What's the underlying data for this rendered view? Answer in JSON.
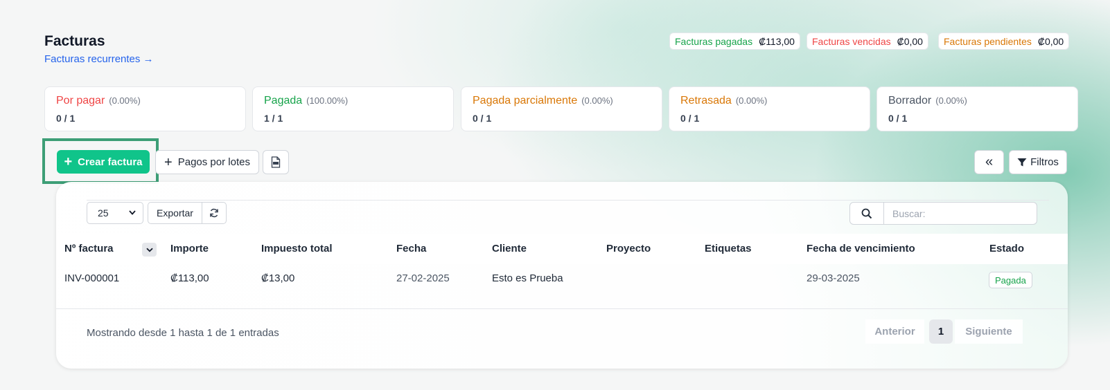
{
  "header": {
    "title": "Facturas",
    "recurring_link": "Facturas recurrentes →"
  },
  "summary": [
    {
      "label": "Facturas pagadas",
      "amount": "₡113,00",
      "color": "#16a34a"
    },
    {
      "label": "Facturas vencidas",
      "amount": "₡0,00",
      "color": "#ef4444"
    },
    {
      "label": "Facturas pendientes",
      "amount": "₡0,00",
      "color": "#d97706"
    }
  ],
  "status_cards": [
    {
      "label": "Por pagar",
      "percent": "(0.00%)",
      "count": "0 / 1",
      "color": "#ef4444"
    },
    {
      "label": "Pagada",
      "percent": "(100.00%)",
      "count": "1 / 1",
      "color": "#16a34a"
    },
    {
      "label": "Pagada parcialmente",
      "percent": "(0.00%)",
      "count": "0 / 1",
      "color": "#d97706"
    },
    {
      "label": "Retrasada",
      "percent": "(0.00%)",
      "count": "0 / 1",
      "color": "#d97706"
    },
    {
      "label": "Borrador",
      "percent": "(0.00%)",
      "count": "0 / 1",
      "color": "#4b5563"
    }
  ],
  "toolbar": {
    "create_label": "Crear factura",
    "batch_label": "Pagos por lotes",
    "filters_label": "Filtros"
  },
  "table_controls": {
    "page_size": "25",
    "export_label": "Exportar",
    "search_placeholder": "Buscar:"
  },
  "table": {
    "columns": [
      "Nº factura",
      "Importe",
      "Impuesto total",
      "Fecha",
      "Cliente",
      "Proyecto",
      "Etiquetas",
      "Fecha de vencimiento",
      "Estado"
    ],
    "rows": [
      {
        "number": "INV-000001",
        "amount": "₡113,00",
        "tax": "₡13,00",
        "date": "27-02-2025",
        "client": "Esto es Prueba",
        "project": "",
        "tags": "",
        "due_date": "29-03-2025",
        "status": "Pagada"
      }
    ]
  },
  "footer": {
    "info": "Mostrando desde 1 hasta 1 de 1 entradas",
    "prev_label": "Anterior",
    "page": "1",
    "next_label": "Siguiente"
  }
}
